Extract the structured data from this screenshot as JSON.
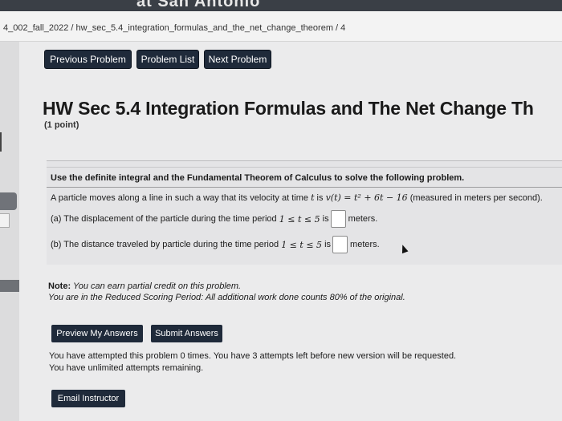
{
  "header": {
    "banner_text": "at San Antonio",
    "breadcrumb": "4_002_fall_2022 / hw_sec_5.4_integration_formulas_and_the_net_change_theorem / 4"
  },
  "nav": {
    "previous_label": "Previous Problem",
    "list_label": "Problem List",
    "next_label": "Next Problem"
  },
  "problem": {
    "title": "HW Sec 5.4 Integration Formulas and The Net Change Th",
    "points": "(1 point)",
    "instructions": "Use the definite integral and the Fundamental Theorem of Calculus to solve the following problem.",
    "statement_prefix": "A particle moves along a line in such a way that its velocity at time",
    "statement_var": "t",
    "statement_mid": "is",
    "statement_math": "v(t) = t² + 6t − 16",
    "statement_suffix": "(measured in meters per second).",
    "part_a_label": "(a) The displacement of the particle during the time period",
    "part_b_label": "(b) The distance traveled by particle during the time period",
    "interval": "1 ≤ t ≤ 5",
    "is_word": "is",
    "unit": "meters.",
    "answer_a": "",
    "answer_b": ""
  },
  "note": {
    "line1_label": "Note:",
    "line1_text": "You can earn partial credit on this problem.",
    "line2": "You are in the Reduced Scoring Period: All additional work done counts 80% of the original."
  },
  "actions": {
    "preview_label": "Preview My Answers",
    "submit_label": "Submit Answers",
    "email_label": "Email Instructor"
  },
  "attempts": {
    "line1": "You have attempted this problem 0 times. You have 3 attempts left before new version will be requested.",
    "line2": "You have unlimited attempts remaining."
  },
  "colors": {
    "button_bg": "#1f2a3a",
    "page_bg": "#ebebec"
  }
}
